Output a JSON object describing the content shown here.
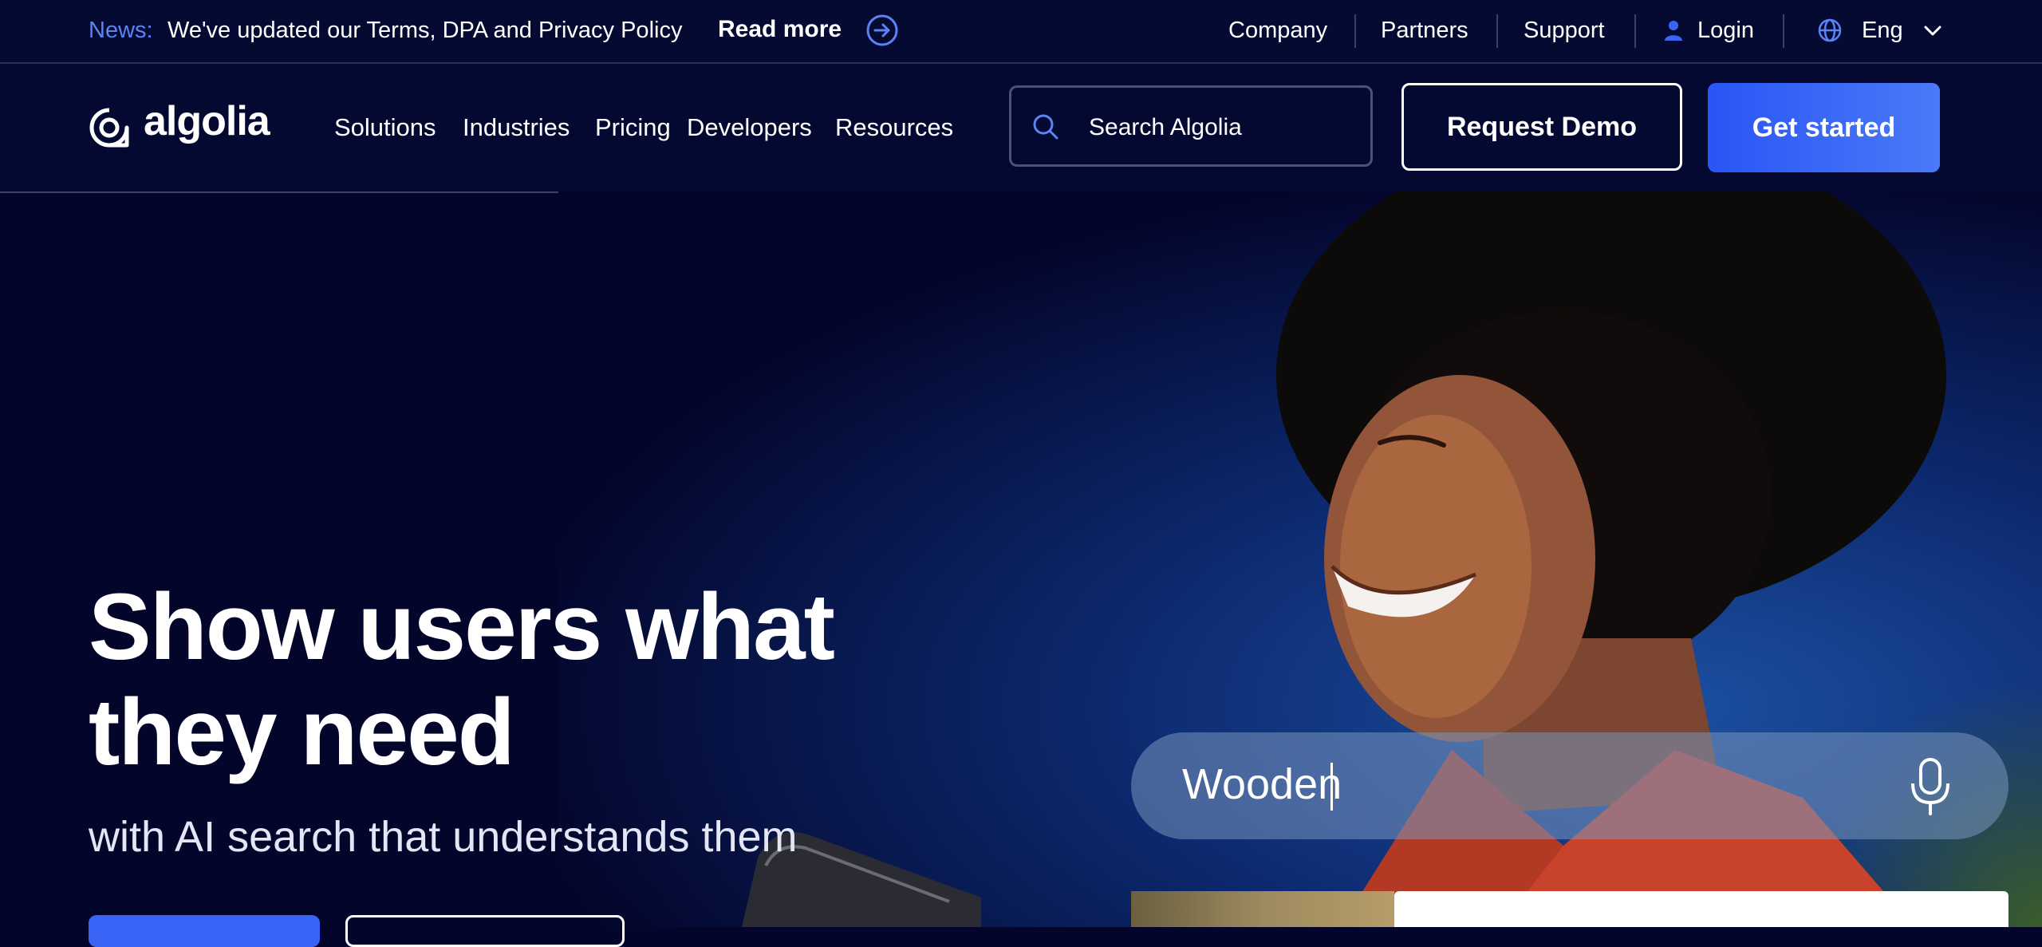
{
  "newsbar": {
    "label": "News:",
    "text": "We've updated our Terms, DPA and Privacy Policy",
    "read_more": "Read more",
    "links": {
      "company": "Company",
      "partners": "Partners",
      "support": "Support",
      "login": "Login",
      "language": "Eng"
    }
  },
  "nav": {
    "brand": "algolia",
    "items": [
      "Solutions",
      "Industries",
      "Pricing",
      "Developers",
      "Resources"
    ],
    "search_placeholder": "Search Algolia",
    "request_demo": "Request Demo",
    "get_started": "Get started"
  },
  "hero": {
    "headline": "Show users what they need",
    "subheadline": "with AI search that understands them",
    "demo_query": "Wooden"
  },
  "colors": {
    "background": "#03052a",
    "accent": "#3a64f5",
    "news_label": "#5a83f5"
  },
  "icons": [
    "arrow-right-circle-icon",
    "user-icon",
    "globe-icon",
    "chevron-down-icon",
    "algolia-logo-icon",
    "search-icon",
    "microphone-icon"
  ]
}
